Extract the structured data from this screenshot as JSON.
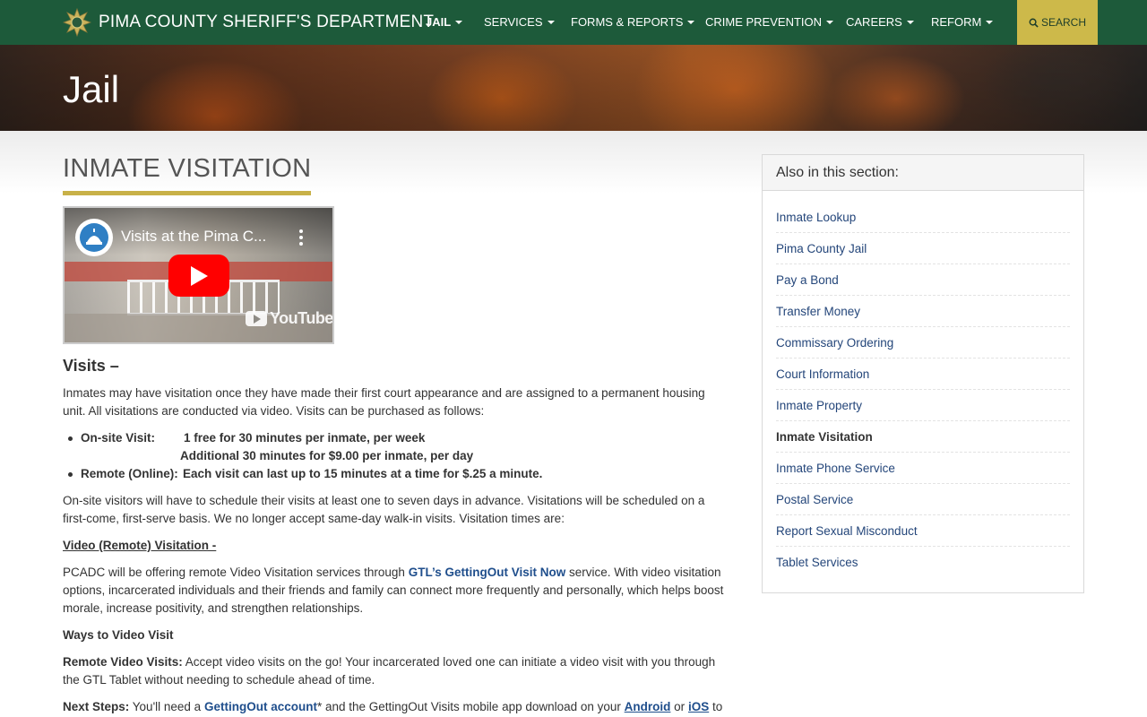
{
  "nav": {
    "brand": "PIMA COUNTY SHERIFF'S DEPARTMENT",
    "items": [
      {
        "label": "JAIL",
        "active": true
      },
      {
        "label": "SERVICES"
      },
      {
        "label": "FORMS & REPORTS"
      },
      {
        "label": "CRIME PREVENTION"
      },
      {
        "label": "CAREERS"
      },
      {
        "label": "REFORM"
      }
    ],
    "search_label": "SEARCH",
    "search_icon": "search-icon"
  },
  "hero": {
    "title": "Jail"
  },
  "page": {
    "title": "INMATE VISITATION"
  },
  "video": {
    "title": "Visits at the Pima C...",
    "brand": "YouTube"
  },
  "content": {
    "visits_heading": "Visits –",
    "intro": "Inmates may have visitation once they have made their first court appearance and are assigned to a permanent housing unit. All visitations are conducted via video.  Visits can be purchased as follows:",
    "bullets": [
      {
        "label": "On-site Visit:",
        "line1": "1 free for 30 minutes per inmate, per week",
        "line2": "Additional 30 minutes for $9.00 per inmate, per day"
      },
      {
        "label": "Remote (Online):",
        "line1": "Each visit can last up to 15 minutes at a time for $.25 a minute."
      }
    ],
    "onsite": "On-site visitors will have to schedule their visits at least one to seven days in advance. Visitations will be scheduled on a first-come, first-serve basis. We no longer accept same-day walk-in visits. Visitation times are:",
    "video_heading": "Video (Remote) Visitation - ",
    "pcadc_a": "PCADC will be offering remote Video Visitation services through ",
    "pcadc_link": "GTL’s GettingOut Visit Now",
    "pcadc_b": " service. With video visitation options, incarcerated individuals and their friends and family can connect more frequently and personally, which helps boost morale, increase positivity, and strengthen relationships.",
    "ways_heading": "Ways to Video Visit",
    "remote_label": "Remote Video Visits:",
    "remote_text": " Accept video visits on the go! Your incarcerated loved one can initiate a video visit with you through the GTL Tablet without needing to schedule ahead of time.",
    "next_label": "Next Steps:",
    "next_a": " You'll need a ",
    "next_link1": "GettingOut account",
    "next_b": "* and the GettingOut Visits mobile app download on your ",
    "next_link2": "Android",
    "next_c": " or ",
    "next_link3": "iOS",
    "next_d": " to"
  },
  "sidebar": {
    "heading": "Also in this section:",
    "items": [
      {
        "label": "Inmate Lookup"
      },
      {
        "label": "Pima County Jail"
      },
      {
        "label": "Pay a Bond"
      },
      {
        "label": "Transfer Money"
      },
      {
        "label": "Commissary Ordering"
      },
      {
        "label": "Court Information"
      },
      {
        "label": "Inmate Property"
      },
      {
        "label": "Inmate Visitation",
        "active": true
      },
      {
        "label": "Inmate Phone Service"
      },
      {
        "label": "Postal Service"
      },
      {
        "label": "Report Sexual Misconduct"
      },
      {
        "label": "Tablet Services"
      }
    ]
  },
  "colors": {
    "nav_bg": "#1d5a3a",
    "accent_gold": "#c8b148",
    "link": "#1f4e8c"
  }
}
